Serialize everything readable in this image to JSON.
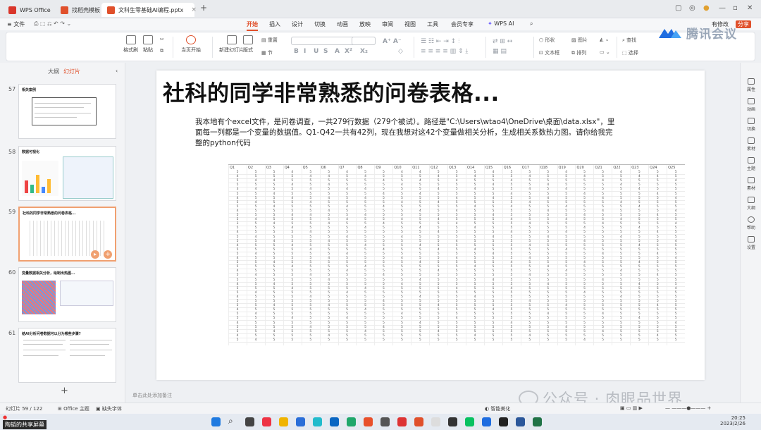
{
  "tabs": [
    {
      "label": "WPS Office",
      "color": "#d9362b",
      "active": false
    },
    {
      "label": "找稻壳模板",
      "color": "#e0502b",
      "active": false
    },
    {
      "label": "文科生零基础AI编程.pptx",
      "color": "#e0502b",
      "active": true
    }
  ],
  "new_tab": "+",
  "menus": [
    "文件",
    "开始",
    "插入",
    "设计",
    "切换",
    "动画",
    "放映",
    "审阅",
    "视图",
    "工具",
    "会员专享",
    "WPS AI"
  ],
  "active_menu": "开始",
  "right_controls": {
    "share": "分享",
    "collab": "有修改"
  },
  "ribbon": {
    "format_painter": "格式刷",
    "paste": "粘贴",
    "start_slideshow": "当页开始",
    "new_slide": "新建幻灯片",
    "layout": "版式",
    "section": "节",
    "reset": "重置",
    "shape": "形状",
    "picture": "图片",
    "textbox": "文本框",
    "arrange": "排列",
    "find": "查找",
    "select": "选择"
  },
  "brand": {
    "name": "腾讯会议",
    "color": "#1f6de0"
  },
  "left_panel": {
    "tab_outline": "大纲",
    "tab_slides": "幻灯片",
    "add": "+",
    "slides": [
      {
        "num": "57",
        "title": "相关案例"
      },
      {
        "num": "58",
        "title": "数据可视化"
      },
      {
        "num": "59",
        "title": "社科的同学非常熟悉的问卷表格...",
        "selected": true
      },
      {
        "num": "60",
        "title": "变量数据相关分析，绘制出热图..."
      },
      {
        "num": "61",
        "title": "结AI分析问卷数据可以分为哪些步骤?"
      }
    ]
  },
  "slide": {
    "title": "社科的同学非常熟悉的问卷表格...",
    "body": "我本地有个excel文件，是问卷调查，一共279行数据（279个被试）。路径是\"C:\\Users\\wtao4\\OneDrive\\桌面\\data.xlsx\"，里面每一列都是一个变量的数据值。Q1-Q42一共有42列，现在我想对这42个变量做相关分析，生成相关系数热力图。请你给我完整的python代码",
    "sheet_headers": [
      "Q1",
      "Q2",
      "Q3",
      "Q4",
      "Q5",
      "Q6",
      "Q7",
      "Q8",
      "Q9",
      "Q10",
      "Q11",
      "Q12",
      "Q13",
      "Q14",
      "Q15",
      "Q16",
      "Q17",
      "Q18",
      "Q19",
      "Q20",
      "Q21",
      "Q22",
      "Q23",
      "Q24",
      "Q25"
    ],
    "sheet_rows": [
      "5 5 5 4 5 5 4 5 5 4 4 5 5 5 4 5 5 5 4 5 5 4 5 5 5",
      "4 5 5 5 4 4 5 4 5 5 5 4 5 4 5 5 4 5 5 4 5 5 4 4 5",
      "5 4 4 5 5 5 5 5 4 5 4 5 4 5 5 4 5 5 5 5 4 5 5 5 4",
      "5 5 5 4 5 4 5 5 5 4 5 5 5 5 4 5 5 4 5 5 5 4 5 5 5",
      "3 4 5 5 4 5 4 4 5 5 5 4 5 4 5 5 4 5 4 5 5 5 4 5 5",
      "5 5 4 5 5 5 5 5 4 5 4 5 5 5 5 4 5 5 5 4 5 5 5 4 5",
      "4 5 5 4 5 4 5 4 5 5 5 5 4 5 4 5 5 4 5 5 4 5 5 5 4",
      "5 4 5 5 4 5 5 5 5 4 5 4 5 5 5 5 4 5 5 5 5 4 5 5 5",
      "5 5 4 5 5 5 4 5 4 5 5 5 5 4 5 4 5 5 4 5 5 5 4 5 5",
      "4 5 5 5 5 4 5 5 5 5 4 5 4 5 5 5 5 4 5 5 4 5 5 5 4",
      "5 5 5 4 4 5 5 4 5 5 5 5 5 5 4 5 5 5 5 4 5 5 5 4 5",
      "5 4 5 5 5 5 4 5 5 4 5 4 5 5 5 4 5 5 4 5 5 4 5 5 5",
      "3 5 4 5 5 4 5 5 4 5 5 5 4 5 5 5 4 5 5 5 4 5 5 5 4",
      "5 5 5 4 5 5 5 4 5 5 4 5 5 4 5 5 5 5 5 4 5 5 4 5 5",
      "4 5 5 5 4 5 5 5 5 5 5 4 5 5 5 4 5 5 4 5 5 5 5 4 5",
      "5 4 5 5 5 5 4 5 5 4 5 5 5 5 4 5 5 4 5 5 5 4 5 5 5",
      "5 5 4 5 5 4 5 5 5 5 5 5 4 5 5 5 5 5 5 4 5 5 5 5 4",
      "4 5 5 4 5 5 5 4 5 5 4 5 5 5 5 5 4 5 5 5 5 5 4 5 5",
      "5 5 5 5 4 5 5 5 4 5 5 4 5 4 5 5 5 5 4 5 5 5 5 5 5",
      "5 4 5 5 5 5 4 5 5 5 5 5 5 5 4 5 5 5 5 5 4 5 5 4 5",
      "4 5 5 5 5 4 5 5 5 4 5 5 4 5 5 5 4 5 5 5 5 5 5 5 4",
      "5 5 4 5 5 5 5 5 5 5 4 5 5 5 5 4 5 5 5 4 5 5 4 5 5",
      "5 5 5 4 5 5 5 4 5 5 5 5 5 4 5 5 5 4 5 5 5 5 5 5 5",
      "4 5 5 5 5 5 4 5 5 5 5 4 5 5 5 5 5 5 4 5 5 4 5 5 5",
      "5 4 5 5 4 5 5 5 4 5 5 5 5 5 5 5 4 5 5 5 5 5 5 4 5",
      "5 5 5 5 5 4 5 5 5 5 4 5 5 5 4 5 5 5 5 5 4 5 5 5 5",
      "4 5 4 5 5 5 5 5 5 4 5 5 5 5 5 5 5 4 5 5 5 5 4 5 5",
      "5 5 5 4 5 5 5 4 5 5 5 5 4 5 5 4 5 5 5 5 5 5 5 5 4",
      "5 4 5 5 5 5 4 5 5 5 5 5 5 5 5 5 5 5 5 4 5 5 5 5 5",
      "4 5 5 5 4 5 5 5 5 5 4 5 5 4 5 5 5 5 5 5 5 4 5 5 5",
      "5 5 5 5 5 5 5 5 4 5 5 5 5 5 5 5 4 5 5 5 5 5 5 5 5",
      "5 5 4 5 5 4 5 5 5 5 5 4 5 5 5 5 5 5 4 5 5 5 5 4 5",
      "4 5 5 5 5 5 5 4 5 5 5 5 5 5 4 5 5 5 5 5 5 5 5 5 5",
      "5 4 5 5 5 5 5 5 5 4 5 5 5 5 5 5 5 4 5 5 4 5 5 5 5",
      "5 5 5 4 5 5 4 5 5 5 5 5 4 5 5 5 5 5 5 5 5 5 4 5 5",
      "4 5 5 5 5 5 5 5 5 5 4 5 5 5 5 4 5 5 5 5 5 5 5 5 4",
      "5 5 5 5 4 5 5 5 4 5 5 5 5 5 5 5 5 5 4 5 5 5 5 5 5",
      "5 5 4 5 5 5 5 4 5 5 5 4 5 5 5 5 5 5 5 5 4 5 5 5 5",
      "4 5 5 5 5 4 5 5 5 5 5 5 5 4 5 5 4 5 5 5 5 5 5 4 5",
      "5 4 5 5 5 5 5 5 5 5 5 5 5 5 5 5 5 5 5 4 5 5 5 5 5"
    ]
  },
  "notes_placeholder": "单击此处添加备注",
  "right_panel": [
    "属性",
    "动画",
    "切换",
    "素材",
    "主题",
    "素材",
    "大纲",
    "帮助",
    "设置"
  ],
  "status": {
    "slide_count": "幻灯片 59 / 122",
    "theme": "Office 主题",
    "missing_font": "缺失字体",
    "smart_beautify": "智能美化",
    "zoom": "—",
    "time": "20:25",
    "date": "2023/2/26"
  },
  "sharing": "陶韬的共享屏幕",
  "watermark": "公众号 · 肉眼品世界"
}
